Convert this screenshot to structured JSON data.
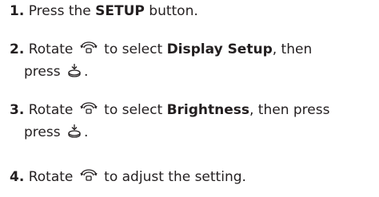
{
  "steps": [
    {
      "number": "1.",
      "pre": "Press the ",
      "keyword": "SETUP",
      "post": " button."
    },
    {
      "number": "2.",
      "pre": "Rotate ",
      "icon_1": "selector-knob-rotate-icon",
      "mid": " to select ",
      "keyword": "Display Setup",
      "post": ", then",
      "line2": "press ",
      "icon_2": "selector-knob-press-icon",
      "end": "."
    },
    {
      "number": "3.",
      "pre": "Rotate ",
      "icon_1": "selector-knob-rotate-icon",
      "mid": " to select ",
      "keyword": "Brightness",
      "post": ", then press",
      "line2": "press ",
      "icon_2": "selector-knob-press-icon",
      "end": "."
    },
    {
      "number": "4.",
      "pre": "Rotate ",
      "icon_1": "selector-knob-rotate-icon",
      "post": " to adjust the setting."
    }
  ]
}
